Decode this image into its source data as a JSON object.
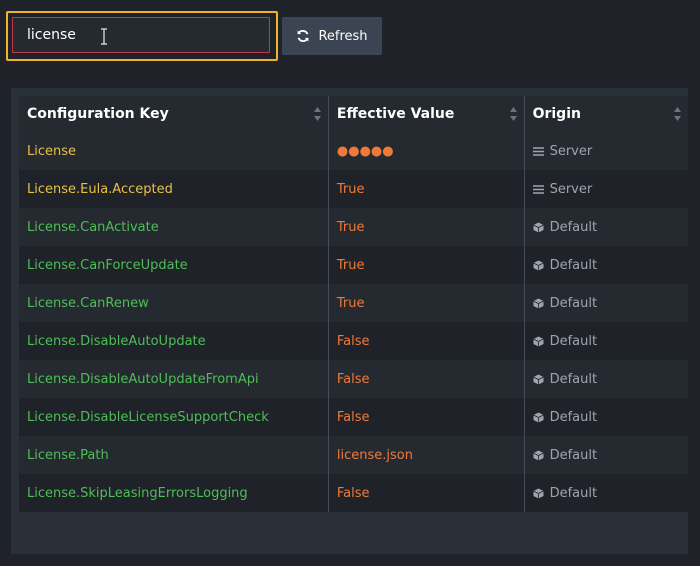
{
  "search": {
    "value": "license"
  },
  "toolbar": {
    "refresh_label": "Refresh"
  },
  "table": {
    "headers": {
      "key": "Configuration Key",
      "value": "Effective Value",
      "origin": "Origin"
    },
    "rows": [
      {
        "key": "License",
        "value": "●●●●●",
        "origin": "Server",
        "key_color": "yellow",
        "origin_icon": "list-icon"
      },
      {
        "key": "License.Eula.Accepted",
        "value": "True",
        "origin": "Server",
        "key_color": "yellow",
        "origin_icon": "list-icon"
      },
      {
        "key": "License.CanActivate",
        "value": "True",
        "origin": "Default",
        "key_color": "green",
        "origin_icon": "cube-icon"
      },
      {
        "key": "License.CanForceUpdate",
        "value": "True",
        "origin": "Default",
        "key_color": "green",
        "origin_icon": "cube-icon"
      },
      {
        "key": "License.CanRenew",
        "value": "True",
        "origin": "Default",
        "key_color": "green",
        "origin_icon": "cube-icon"
      },
      {
        "key": "License.DisableAutoUpdate",
        "value": "False",
        "origin": "Default",
        "key_color": "green",
        "origin_icon": "cube-icon"
      },
      {
        "key": "License.DisableAutoUpdateFromApi",
        "value": "False",
        "origin": "Default",
        "key_color": "green",
        "origin_icon": "cube-icon"
      },
      {
        "key": "License.DisableLicenseSupportCheck",
        "value": "False",
        "origin": "Default",
        "key_color": "green",
        "origin_icon": "cube-icon"
      },
      {
        "key": "License.Path",
        "value": "license.json",
        "origin": "Default",
        "key_color": "green",
        "origin_icon": "cube-icon"
      },
      {
        "key": "License.SkipLeasingErrorsLogging",
        "value": "False",
        "origin": "Default",
        "key_color": "green",
        "origin_icon": "cube-icon"
      }
    ]
  },
  "colors": {
    "focus_outline": "#f0b429",
    "key_yellow": "#e8c046",
    "key_green": "#4ebe56",
    "value_orange": "#ee7a3a",
    "origin_gray": "#9ea5ad"
  }
}
